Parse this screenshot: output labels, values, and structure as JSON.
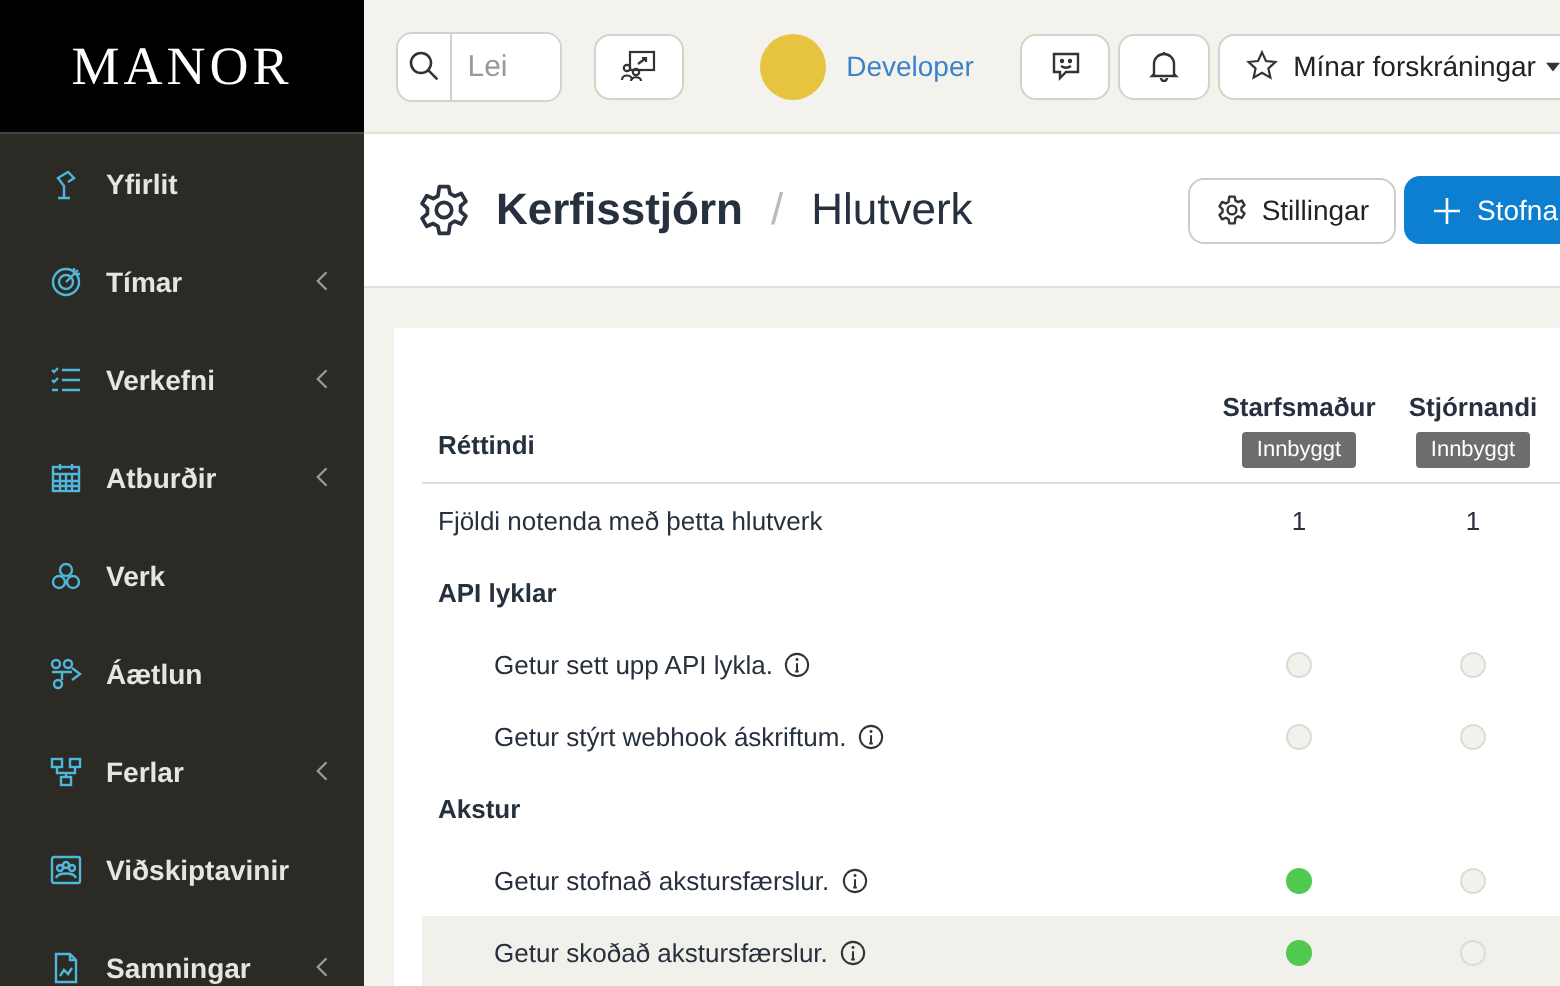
{
  "sidebar": {
    "logo": "MANOR",
    "items": [
      {
        "label": "Yfirlit",
        "has_submenu": false
      },
      {
        "label": "Tímar",
        "has_submenu": true
      },
      {
        "label": "Verkefni",
        "has_submenu": true
      },
      {
        "label": "Atburðir",
        "has_submenu": true
      },
      {
        "label": "Verk",
        "has_submenu": false
      },
      {
        "label": "Áætlun",
        "has_submenu": false
      },
      {
        "label": "Ferlar",
        "has_submenu": true
      },
      {
        "label": "Viðskiptavinir",
        "has_submenu": false
      },
      {
        "label": "Samningar",
        "has_submenu": true
      }
    ]
  },
  "topbar": {
    "search": {
      "placeholder": "Lei"
    },
    "user": {
      "name": "Developer"
    },
    "favorites": {
      "label": "Mínar forskráningar"
    }
  },
  "page_header": {
    "breadcrumb": [
      "Kerfisstjórn",
      "Hlutverk"
    ],
    "separator": "/",
    "settings_button": "Stillingar",
    "create_button": "Stofna"
  },
  "table": {
    "first_column": "Réttindi",
    "roles": [
      {
        "name": "Starfsmaður",
        "badge": "Innbyggt"
      },
      {
        "name": "Stjórnandi",
        "badge": "Innbyggt"
      }
    ],
    "rows": [
      {
        "kind": "count",
        "label": "Fjöldi notenda með þetta hlutverk",
        "values": [
          "1",
          "1"
        ],
        "highlighted": false
      },
      {
        "kind": "group",
        "label": "API lyklar",
        "highlighted": false
      },
      {
        "kind": "permission",
        "label": "Getur sett upp API lykla.",
        "granted": [
          false,
          false
        ],
        "highlighted": false
      },
      {
        "kind": "permission",
        "label": "Getur stýrt webhook áskriftum.",
        "granted": [
          false,
          false
        ],
        "highlighted": false
      },
      {
        "kind": "group",
        "label": "Akstur",
        "highlighted": false
      },
      {
        "kind": "permission",
        "label": "Getur stofnað akstursfærslur.",
        "granted": [
          true,
          false
        ],
        "highlighted": false
      },
      {
        "kind": "permission",
        "label": "Getur skoðað akstursfærslur.",
        "granted": [
          true,
          false
        ],
        "highlighted": true
      }
    ]
  }
}
